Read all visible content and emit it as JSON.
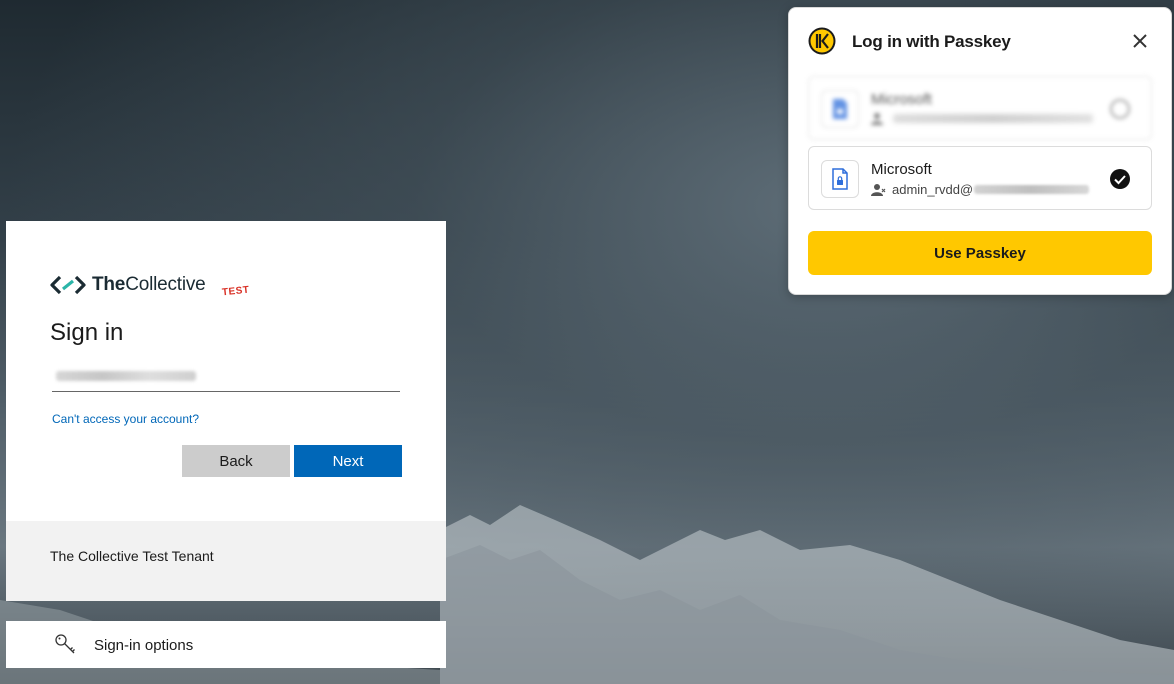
{
  "signin": {
    "logo_text_bold": "The",
    "logo_text_rest": "Collective",
    "logo_badge": "TEST",
    "title": "Sign in",
    "email_value": "",
    "cant_access_link": "Can't access your account?",
    "back_label": "Back",
    "next_label": "Next",
    "tenant_name": "The Collective Test Tenant"
  },
  "signin_options": {
    "label": "Sign-in options",
    "icon": "key-icon"
  },
  "passkey_popup": {
    "title": "Log in with Passkey",
    "accounts": [
      {
        "service": "Microsoft",
        "user": "",
        "selected": false,
        "blurred": true
      },
      {
        "service": "Microsoft",
        "user": "admin_rvdd@",
        "selected": true,
        "blurred": false
      }
    ],
    "use_button_label": "Use Passkey",
    "accent_color": "#ffc800"
  },
  "colors": {
    "primary_button": "#0067b8",
    "secondary_button": "#cccccc",
    "link": "#0067b8"
  }
}
